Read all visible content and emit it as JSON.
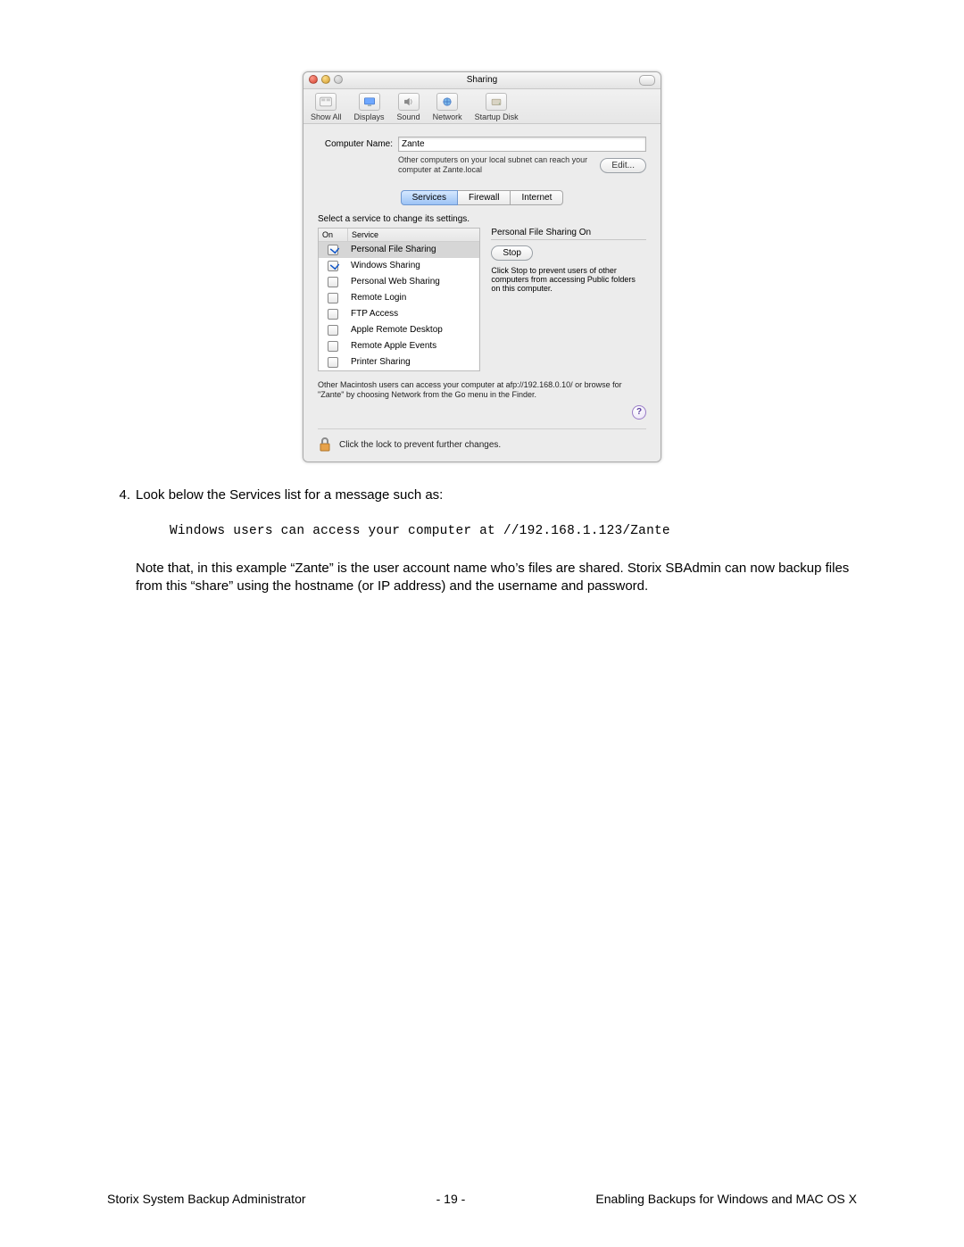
{
  "window": {
    "title": "Sharing",
    "toolbar": [
      {
        "label": "Show All"
      },
      {
        "label": "Displays"
      },
      {
        "label": "Sound"
      },
      {
        "label": "Network"
      },
      {
        "label": "Startup Disk"
      }
    ],
    "computer_name_label": "Computer Name:",
    "computer_name_value": "Zante",
    "hint": "Other computers on your local subnet can reach your computer at Zante.local",
    "edit_label": "Edit...",
    "tabs": {
      "services": "Services",
      "firewall": "Firewall",
      "internet": "Internet"
    },
    "select_label": "Select a service to change its settings.",
    "table_head": {
      "on": "On",
      "service": "Service"
    },
    "services": [
      {
        "on": true,
        "name": "Personal File Sharing",
        "selected": true
      },
      {
        "on": true,
        "name": "Windows Sharing"
      },
      {
        "on": false,
        "name": "Personal Web Sharing"
      },
      {
        "on": false,
        "name": "Remote Login"
      },
      {
        "on": false,
        "name": "FTP Access"
      },
      {
        "on": false,
        "name": "Apple Remote Desktop"
      },
      {
        "on": false,
        "name": "Remote Apple Events"
      },
      {
        "on": false,
        "name": "Printer Sharing"
      }
    ],
    "status_title": "Personal File Sharing On",
    "stop_label": "Stop",
    "stop_hint": "Click Stop to prevent users of other computers from accessing Public folders on this computer.",
    "bottom_note": "Other Macintosh users can access your computer at afp://192.168.0.10/ or browse for \"Zante\" by choosing Network from the Go menu in the Finder.",
    "help_glyph": "?",
    "lock_text": "Click the lock to prevent further changes."
  },
  "doc": {
    "step_num": "4.",
    "step_text": "Look below the Services list for a message such as:",
    "code": "Windows users can access your computer at //192.168.1.123/Zante",
    "para": "Note that, in this example “Zante” is the user account name who’s files are shared. Storix SBAdmin can now backup files from this “share” using the hostname (or IP address) and the username and password."
  },
  "footer": {
    "left": "Storix System Backup Administrator",
    "center": "- 19 -",
    "right": "Enabling Backups for Windows and MAC OS X"
  }
}
